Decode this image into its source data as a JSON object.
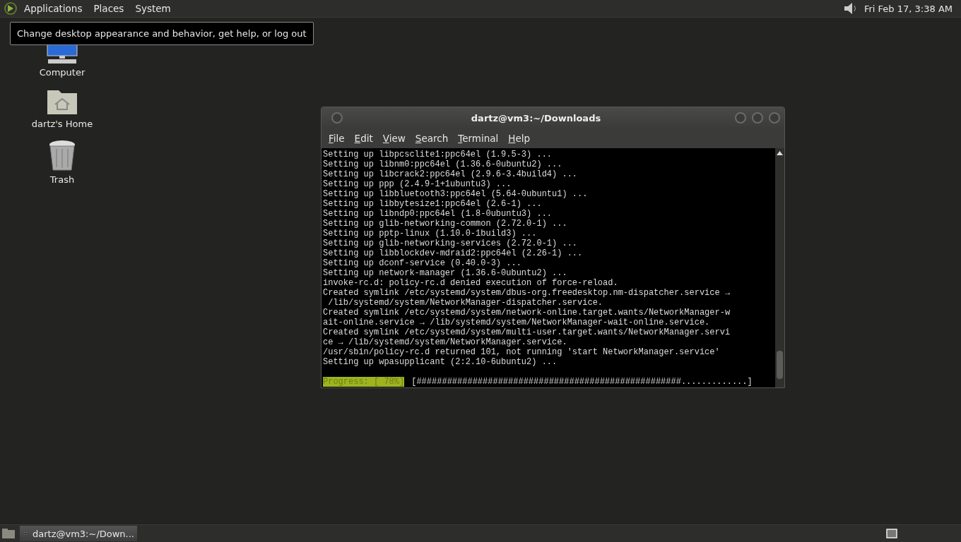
{
  "top_panel": {
    "menus": [
      "Applications",
      "Places",
      "System"
    ],
    "clock": "Fri Feb 17,  3:38 AM"
  },
  "tooltip": "Change desktop appearance and behavior, get help, or log out",
  "desktop_icons": [
    {
      "kind": "computer",
      "label": "Computer"
    },
    {
      "kind": "home",
      "label": "dartz's Home"
    },
    {
      "kind": "trash",
      "label": "Trash"
    }
  ],
  "terminal": {
    "title": "dartz@vm3:~/Downloads",
    "menu": [
      "File",
      "Edit",
      "View",
      "Search",
      "Terminal",
      "Help"
    ],
    "lines": [
      "Setting up libpcsclite1:ppc64el (1.9.5-3) ...",
      "Setting up libnm0:ppc64el (1.36.6-0ubuntu2) ...",
      "Setting up libcrack2:ppc64el (2.9.6-3.4build4) ...",
      "Setting up ppp (2.4.9-1+1ubuntu3) ...",
      "Setting up libbluetooth3:ppc64el (5.64-0ubuntu1) ...",
      "Setting up libbytesize1:ppc64el (2.6-1) ...",
      "Setting up libndp0:ppc64el (1.8-0ubuntu3) ...",
      "Setting up glib-networking-common (2.72.0-1) ...",
      "Setting up pptp-linux (1.10.0-1build3) ...",
      "Setting up glib-networking-services (2.72.0-1) ...",
      "Setting up libblockdev-mdraid2:ppc64el (2.26-1) ...",
      "Setting up dconf-service (0.40.0-3) ...",
      "Setting up network-manager (1.36.6-0ubuntu2) ...",
      "invoke-rc.d: policy-rc.d denied execution of force-reload.",
      "Created symlink /etc/systemd/system/dbus-org.freedesktop.nm-dispatcher.service →",
      " /lib/systemd/system/NetworkManager-dispatcher.service.",
      "Created symlink /etc/systemd/system/network-online.target.wants/NetworkManager-w",
      "ait-online.service → /lib/systemd/system/NetworkManager-wait-online.service.",
      "Created symlink /etc/systemd/system/multi-user.target.wants/NetworkManager.servi",
      "ce → /lib/systemd/system/NetworkManager.service.",
      "/usr/sbin/policy-rc.d returned 101, not running 'start NetworkManager.service'",
      "Setting up wpasupplicant (2:2.10-6ubuntu2) ..."
    ],
    "progress_label": "Progress: [ 78%]",
    "progress_bar": "[####################################################.............]"
  },
  "taskbar": {
    "tasks": [
      {
        "label": "dartz@vm3:~/Down...",
        "selected": true
      }
    ]
  }
}
